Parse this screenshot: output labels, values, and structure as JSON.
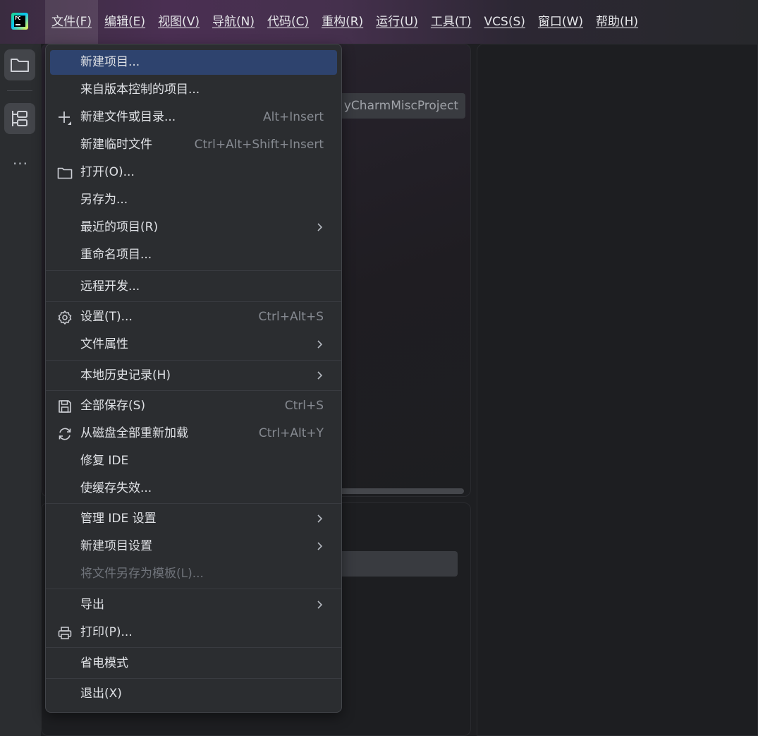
{
  "menubar": {
    "logo_text": "PC",
    "items": [
      "文件(F)",
      "编辑(E)",
      "视图(V)",
      "导航(N)",
      "代码(C)",
      "重构(R)",
      "运行(U)",
      "工具(T)",
      "VCS(S)",
      "窗口(W)",
      "帮助(H)"
    ]
  },
  "toolstrip": {
    "more": "..."
  },
  "background": {
    "project_chip": "yCharmMiscProject"
  },
  "dropdown": {
    "items": [
      {
        "label": "新建项目...",
        "shortcut": "",
        "icon": "",
        "submenu": false
      },
      {
        "label": "来自版本控制的项目...",
        "shortcut": "",
        "icon": "",
        "submenu": false
      },
      {
        "label": "新建文件或目录...",
        "shortcut": "Alt+Insert",
        "icon": "plus-icon",
        "submenu": false
      },
      {
        "label": "新建临时文件",
        "shortcut": "Ctrl+Alt+Shift+Insert",
        "icon": "",
        "submenu": false
      },
      {
        "label": "打开(O)...",
        "shortcut": "",
        "icon": "folder-icon",
        "submenu": false
      },
      {
        "label": "另存为...",
        "shortcut": "",
        "icon": "",
        "submenu": false
      },
      {
        "label": "最近的项目(R)",
        "shortcut": "",
        "icon": "",
        "submenu": true
      },
      {
        "label": "重命名项目...",
        "shortcut": "",
        "icon": "",
        "submenu": false
      },
      {
        "label": "远程开发...",
        "shortcut": "",
        "icon": "",
        "submenu": false
      },
      {
        "label": "设置(T)...",
        "shortcut": "Ctrl+Alt+S",
        "icon": "gear-icon",
        "submenu": false
      },
      {
        "label": "文件属性",
        "shortcut": "",
        "icon": "",
        "submenu": true
      },
      {
        "label": "本地历史记录(H)",
        "shortcut": "",
        "icon": "",
        "submenu": true
      },
      {
        "label": "全部保存(S)",
        "shortcut": "Ctrl+S",
        "icon": "save-icon",
        "submenu": false
      },
      {
        "label": "从磁盘全部重新加载",
        "shortcut": "Ctrl+Alt+Y",
        "icon": "reload-icon",
        "submenu": false
      },
      {
        "label": "修复 IDE",
        "shortcut": "",
        "icon": "",
        "submenu": false
      },
      {
        "label": "使缓存失效...",
        "shortcut": "",
        "icon": "",
        "submenu": false
      },
      {
        "label": "管理 IDE 设置",
        "shortcut": "",
        "icon": "",
        "submenu": true
      },
      {
        "label": "新建项目设置",
        "shortcut": "",
        "icon": "",
        "submenu": true
      },
      {
        "label": "将文件另存为模板(L)...",
        "shortcut": "",
        "icon": "",
        "submenu": false,
        "disabled": true
      },
      {
        "label": "导出",
        "shortcut": "",
        "icon": "",
        "submenu": true
      },
      {
        "label": "打印(P)...",
        "shortcut": "",
        "icon": "printer-icon",
        "submenu": false
      },
      {
        "label": "省电模式",
        "shortcut": "",
        "icon": "",
        "submenu": false
      },
      {
        "label": "退出(X)",
        "shortcut": "",
        "icon": "",
        "submenu": false
      }
    ]
  }
}
